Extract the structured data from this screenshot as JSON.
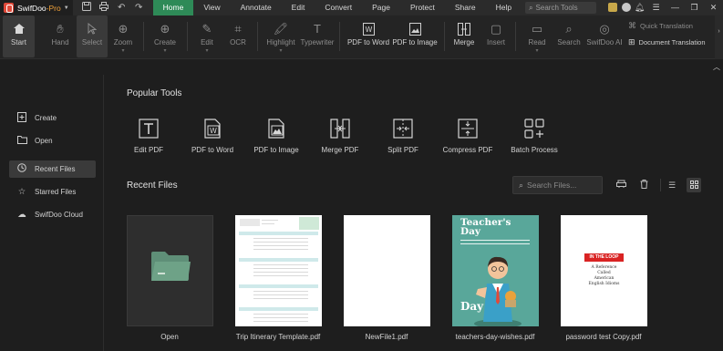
{
  "app": {
    "name": "SwifDoo",
    "edition": "-Pro"
  },
  "menu": {
    "items": [
      "Home",
      "View",
      "Annotate",
      "Edit",
      "Convert",
      "Page",
      "Protect",
      "Share",
      "Help"
    ],
    "active": "Home",
    "search_placeholder": "Search Tools"
  },
  "ribbon": {
    "start": "Start",
    "hand": "Hand",
    "select": "Select",
    "zoom": "Zoom",
    "create": "Create",
    "edit": "Edit",
    "ocr": "OCR",
    "highlight": "Highlight",
    "typewriter": "Typewriter",
    "pdf_to_word": "PDF to Word",
    "pdf_to_image": "PDF to Image",
    "merge": "Merge",
    "insert": "Insert",
    "read": "Read",
    "search": "Search",
    "swifdoo_ai": "SwifDoo AI",
    "quick_translation": "Quick Translation",
    "document_translation": "Document Translation"
  },
  "sidebar": {
    "items": [
      {
        "label": "Create",
        "icon": "add-document-icon"
      },
      {
        "label": "Open",
        "icon": "folder-open-icon"
      },
      {
        "label": "Recent Files",
        "icon": "clock-icon"
      },
      {
        "label": "Starred Files",
        "icon": "star-icon"
      },
      {
        "label": "SwifDoo Cloud",
        "icon": "cloud-icon"
      }
    ],
    "active": "Recent Files"
  },
  "popular_tools": {
    "title": "Popular Tools",
    "items": [
      {
        "label": "Edit PDF",
        "icon": "edit-pdf-icon"
      },
      {
        "label": "PDF to Word",
        "icon": "pdf-to-word-icon"
      },
      {
        "label": "PDF to Image",
        "icon": "pdf-to-image-icon"
      },
      {
        "label": "Merge PDF",
        "icon": "merge-pdf-icon"
      },
      {
        "label": "Split PDF",
        "icon": "split-pdf-icon"
      },
      {
        "label": "Compress PDF",
        "icon": "compress-pdf-icon"
      },
      {
        "label": "Batch Process",
        "icon": "batch-process-icon"
      }
    ]
  },
  "recent_files": {
    "title": "Recent Files",
    "search_placeholder": "Search Files...",
    "view_mode": "grid",
    "items": [
      {
        "name": "Open"
      },
      {
        "name": "Trip Itinerary Template.pdf"
      },
      {
        "name": "NewFile1.pdf"
      },
      {
        "name": "teachers-day-wishes.pdf"
      },
      {
        "name": "password test Copy.pdf"
      }
    ]
  },
  "thumbnails": {
    "teacher_line1": "Teacher's",
    "teacher_line2": "Day",
    "password_banner": "IN THE LOOP",
    "password_lines": [
      "A Reference",
      "Called",
      "American",
      "English Idioms"
    ]
  },
  "colors": {
    "accent": "#2e8a57",
    "background": "#1e1e1e",
    "brand_red": "#e04a3a",
    "pro_orange": "#f3a33a"
  }
}
